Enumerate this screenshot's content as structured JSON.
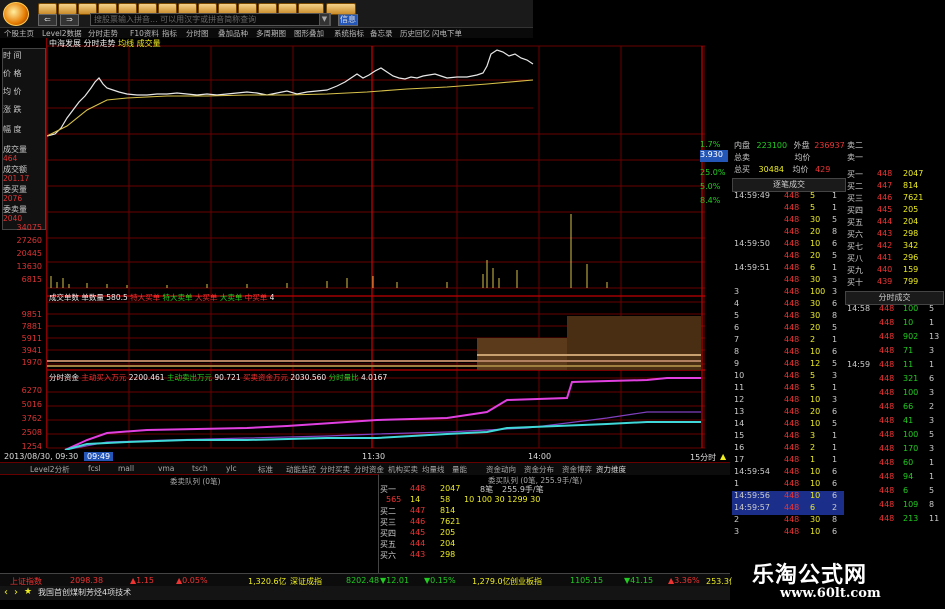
{
  "toolbar": {
    "search_placeholder": "搜股票输入拼音...  可以用汉字或拼音简称查询",
    "nav_back": "⇐",
    "nav_fwd": "⇒",
    "info_btn": "信息"
  },
  "menu": [
    "个股主页",
    "Level2数据",
    "分时走势",
    "F10资料",
    "指标",
    "分时图",
    "叠加品种",
    "多周期图",
    "图形叠加",
    "系统指标",
    "备忘录",
    "历史回忆",
    "闪电下单"
  ],
  "chart_header": {
    "title": "中海发展 分时走势",
    "series1": "均线",
    "series2": "成交量"
  },
  "left_labels": {
    "time_label": "时 间",
    "price_label": "价 格",
    "avg_label": "均 价",
    "change_label": "涨 跌",
    "amp_label": "幅 度",
    "vol_label": "成交量",
    "vol_value": "464",
    "amount_label": "成交额",
    "amount_value": "201.17",
    "buy_label": "委买量",
    "buy_value": "2076",
    "sell_label": "委卖量",
    "sell_value": "2040"
  },
  "vol_axis": [
    "34075",
    "27260",
    "20445",
    "13630",
    "6815"
  ],
  "mid_header": {
    "label": "成交单数",
    "sub": "单数量",
    "v1": "580.5",
    "l2": "特大买单",
    "l3": "特大卖单",
    "l4": "大买单",
    "l5": "大卖单",
    "l6": "中买单",
    "v6": "4"
  },
  "mid_axis": [
    "9851",
    "7881",
    "5911",
    "3941",
    "1970"
  ],
  "low_header": {
    "label": "分时资金",
    "l1": "主动买入万元",
    "v1": "2200.461",
    "l2": "主动卖出万元",
    "v2": "90.721",
    "l3": "买卖资金万元",
    "v3": "2030.560",
    "l4": "分时量比",
    "v4": "4.0167"
  },
  "low_axis": [
    "6270",
    "5016",
    "3762",
    "2508",
    "1254"
  ],
  "time_axis": {
    "date": "2013/08/30, 09:30",
    "t2": "09:49",
    "t3": "11:30",
    "t4": "14:00",
    "period": "15分时"
  },
  "tabs": [
    "Level2分析",
    "fcsl",
    "mall",
    "vma",
    "tsch",
    "ylc",
    "标准",
    "动能监控",
    "分时买卖",
    "分时资金",
    "机构买卖",
    "均量线",
    "量能",
    "资金动向",
    "资金分布",
    "资金博弈",
    "资力维度"
  ],
  "bottom_titles": {
    "left": "委卖队列 (0笔)",
    "right": "委买队列 (0笔, 255.9手/笔)"
  },
  "order_rows": [
    {
      "label": "买一",
      "price": "448",
      "vol": "2047",
      "extra": "8笔",
      "extra2": "255.9手/笔"
    },
    {
      "label": "",
      "price": "565",
      "vol": "14",
      "extra": "58",
      "extra2": "10   100   30   1299   30"
    },
    {
      "label": "买二",
      "price": "447",
      "vol": "814",
      "extra": "",
      "extra2": ""
    },
    {
      "label": "买三",
      "price": "446",
      "vol": "7621",
      "extra": "",
      "extra2": ""
    },
    {
      "label": "买四",
      "price": "445",
      "vol": "205",
      "extra": "",
      "extra2": ""
    },
    {
      "label": "买五",
      "price": "444",
      "vol": "204",
      "extra": "",
      "extra2": ""
    },
    {
      "label": "买六",
      "price": "443",
      "vol": "298",
      "extra": "",
      "extra2": ""
    }
  ],
  "status_bar": {
    "idx1": "上证指数",
    "v1": "2098.38",
    "c1": "▲1.15",
    "p1": "▲0.05%",
    "amt1": "1,320.6亿",
    "idx2": "深证成指",
    "v2": "8202.48",
    "c2": "▼12.01",
    "p2": "▼0.15%",
    "amt2": "1,279.0亿",
    "idx3": "创业板指",
    "v3": "1105.15",
    "c3": "▼41.15",
    "p3": "▲3.36%",
    "amt3": "253.3亿"
  },
  "ticker": "我国首创煤制芳烃4项技术",
  "right_panel": {
    "pct": [
      "1.7%",
      "3.930",
      "25.0%",
      "5.0%",
      "8.4%"
    ],
    "inner_label": "内盘",
    "inner_val": "223100",
    "outer_label": "外盘",
    "outer_val": "236937",
    "total_sell_label": "总卖",
    "total_sell_avg": "均价",
    "total_buy_label": "总买",
    "total_buy_val": "30484",
    "total_buy_avg": "均价",
    "total_buy_avgv": "429",
    "sell_side": [
      {
        "label": "卖二",
        "price": "",
        "vol": ""
      },
      {
        "label": "卖一",
        "price": "",
        "vol": ""
      }
    ],
    "buy_side": [
      {
        "label": "买一",
        "price": "448",
        "vol": "2047"
      },
      {
        "label": "买二",
        "price": "447",
        "vol": "814"
      },
      {
        "label": "买三",
        "price": "446",
        "vol": "7621"
      },
      {
        "label": "买四",
        "price": "445",
        "vol": "205"
      },
      {
        "label": "买五",
        "price": "444",
        "vol": "204"
      },
      {
        "label": "买六",
        "price": "443",
        "vol": "298"
      },
      {
        "label": "买七",
        "price": "442",
        "vol": "342"
      },
      {
        "label": "买八",
        "price": "441",
        "vol": "296"
      },
      {
        "label": "买九",
        "price": "440",
        "vol": "159"
      },
      {
        "label": "买十",
        "price": "439",
        "vol": "799"
      }
    ],
    "trades_title": "逐笔成交",
    "trades": [
      {
        "t": "14:59:49",
        "p": "448",
        "v": "5",
        "a": "1"
      },
      {
        "t": "",
        "p": "448",
        "v": "5",
        "a": "1"
      },
      {
        "t": "",
        "p": "448",
        "v": "30",
        "a": "5"
      },
      {
        "t": "",
        "p": "448",
        "v": "20",
        "a": "8"
      },
      {
        "t": "14:59:50",
        "p": "448",
        "v": "10",
        "a": "6"
      },
      {
        "t": "",
        "p": "448",
        "v": "20",
        "a": "5"
      },
      {
        "t": "14:59:51",
        "p": "448",
        "v": "6",
        "a": "1"
      },
      {
        "t": "",
        "p": "448",
        "v": "30",
        "a": "3"
      },
      {
        "t": "3",
        "p": "448",
        "v": "100",
        "a": "3"
      },
      {
        "t": "4",
        "p": "448",
        "v": "30",
        "a": "6"
      },
      {
        "t": "5",
        "p": "448",
        "v": "30",
        "a": "8"
      },
      {
        "t": "6",
        "p": "448",
        "v": "20",
        "a": "5"
      },
      {
        "t": "7",
        "p": "448",
        "v": "2",
        "a": "1"
      },
      {
        "t": "8",
        "p": "448",
        "v": "10",
        "a": "6"
      },
      {
        "t": "9",
        "p": "448",
        "v": "12",
        "a": "5"
      },
      {
        "t": "10",
        "p": "448",
        "v": "5",
        "a": "3"
      },
      {
        "t": "11",
        "p": "448",
        "v": "5",
        "a": "1"
      },
      {
        "t": "12",
        "p": "448",
        "v": "10",
        "a": "3"
      },
      {
        "t": "13",
        "p": "448",
        "v": "20",
        "a": "6"
      },
      {
        "t": "14",
        "p": "448",
        "v": "10",
        "a": "5"
      },
      {
        "t": "15",
        "p": "448",
        "v": "3",
        "a": "1"
      },
      {
        "t": "16",
        "p": "448",
        "v": "2",
        "a": "1"
      },
      {
        "t": "17",
        "p": "448",
        "v": "1",
        "a": "1"
      },
      {
        "t": "14:59:54",
        "p": "448",
        "v": "10",
        "a": "6"
      },
      {
        "t": "1",
        "p": "448",
        "v": "10",
        "a": "6"
      },
      {
        "t": "14:59:56",
        "p": "448",
        "v": "10",
        "a": "6"
      },
      {
        "t": "14:59:57",
        "p": "448",
        "v": "6",
        "a": "2"
      },
      {
        "t": "2",
        "p": "448",
        "v": "30",
        "a": "8"
      },
      {
        "t": "3",
        "p": "448",
        "v": "10",
        "a": "6"
      }
    ],
    "min_title": "分时成交",
    "minute": [
      {
        "t": "14:58",
        "p": "448",
        "v": "100",
        "a": "5"
      },
      {
        "t": "",
        "p": "448",
        "v": "10",
        "a": "1"
      },
      {
        "t": "",
        "p": "448",
        "v": "902",
        "a": "13"
      },
      {
        "t": "",
        "p": "448",
        "v": "71",
        "a": "3"
      },
      {
        "t": "14:59",
        "p": "448",
        "v": "11",
        "a": "1"
      },
      {
        "t": "",
        "p": "448",
        "v": "321",
        "a": "6"
      },
      {
        "t": "",
        "p": "448",
        "v": "100",
        "a": "3"
      },
      {
        "t": "",
        "p": "448",
        "v": "66",
        "a": "2"
      },
      {
        "t": "",
        "p": "448",
        "v": "41",
        "a": "3"
      },
      {
        "t": "",
        "p": "448",
        "v": "100",
        "a": "5"
      },
      {
        "t": "",
        "p": "448",
        "v": "170",
        "a": "3"
      },
      {
        "t": "",
        "p": "448",
        "v": "60",
        "a": "1"
      },
      {
        "t": "",
        "p": "448",
        "v": "94",
        "a": "1"
      },
      {
        "t": "",
        "p": "448",
        "v": "6",
        "a": "5"
      },
      {
        "t": "",
        "p": "448",
        "v": "109",
        "a": "8"
      },
      {
        "t": "",
        "p": "448",
        "v": "213",
        "a": "11"
      }
    ]
  },
  "watermark": {
    "line1": "乐淘公式网",
    "line2": "www.60lt.com"
  }
}
